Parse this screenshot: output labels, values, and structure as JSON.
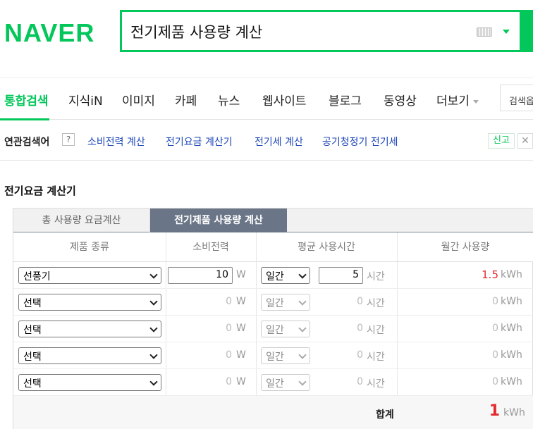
{
  "brand": {
    "logo": "NAVER",
    "color": "#03c75a"
  },
  "search": {
    "query": "전기제품 사용량 계산",
    "keyboard_icon": "keyboard-icon",
    "dropdown_icon": "chevron-down-icon"
  },
  "nav": {
    "items": [
      "통합검색",
      "지식iN",
      "이미지",
      "카페",
      "뉴스",
      "웹사이트",
      "블로그",
      "동영상",
      "더보기"
    ],
    "active": "통합검색",
    "search_option": "검색옵"
  },
  "related": {
    "title": "연관검색어",
    "help": "?",
    "links": [
      "소비전력 계산",
      "전기요금 계산기",
      "전기세 계산",
      "공기청정기 전기세"
    ],
    "report": "신고",
    "close": "✕"
  },
  "calculator": {
    "title": "전기요금 계산기",
    "tabs": [
      "총 사용량 요금계산",
      "전기제품 사용량 계산"
    ],
    "active_tab": "전기제품 사용량 계산",
    "headers": [
      "제품 종류",
      "소비전력",
      "평균 사용시간",
      "월간 사용량"
    ],
    "rows": [
      {
        "product": "선풍기",
        "watt": "10",
        "watt_unit": "W",
        "period": "일간",
        "hours": "5",
        "hours_unit": "시간",
        "monthly": "1.5",
        "monthly_unit": "kWh"
      },
      {
        "product": "선택",
        "watt": "0",
        "watt_unit": "W",
        "period": "일간",
        "hours": "0",
        "hours_unit": "시간",
        "monthly": "0",
        "monthly_unit": "kWh"
      },
      {
        "product": "선택",
        "watt": "0",
        "watt_unit": "W",
        "period": "일간",
        "hours": "0",
        "hours_unit": "시간",
        "monthly": "0",
        "monthly_unit": "kWh"
      },
      {
        "product": "선택",
        "watt": "0",
        "watt_unit": "W",
        "period": "일간",
        "hours": "0",
        "hours_unit": "시간",
        "monthly": "0",
        "monthly_unit": "kWh"
      },
      {
        "product": "선택",
        "watt": "0",
        "watt_unit": "W",
        "period": "일간",
        "hours": "0",
        "hours_unit": "시간",
        "monthly": "0",
        "monthly_unit": "kWh"
      }
    ],
    "total_label": "합계",
    "total_value": "1",
    "total_unit": "kWh",
    "accent_color": "#e4292e"
  }
}
